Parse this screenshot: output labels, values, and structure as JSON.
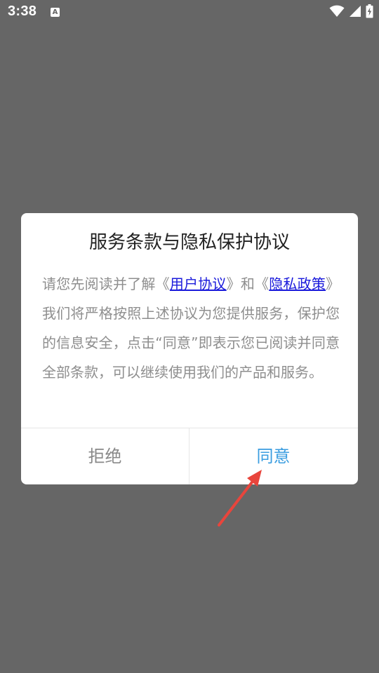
{
  "status_bar": {
    "time": "3:38",
    "a_icon_letter": "A"
  },
  "dialog": {
    "title": "服务条款与隐私保护协议",
    "body": {
      "part1": "请您先阅读并了解《",
      "link_user_agreement": "用户协议",
      "part2": "》和《",
      "link_privacy_policy": "隐私政策",
      "part3": "》我们将严格按照上述协议为您提供服务，保护您的信息安全，点击“同意”即表示您已阅读并同意全部条款，可以继续使用我们的产品和服务。"
    },
    "buttons": {
      "reject": "拒绝",
      "agree": "同意"
    }
  },
  "colors": {
    "overlay": "#666666",
    "link": "#1a1adb",
    "agree": "#3a9de0",
    "annotation_arrow": "#e8453c"
  },
  "icons": [
    "wifi-icon",
    "cellular-signal-icon",
    "battery-charging-icon",
    "font-a-icon",
    "annotation-arrow"
  ]
}
